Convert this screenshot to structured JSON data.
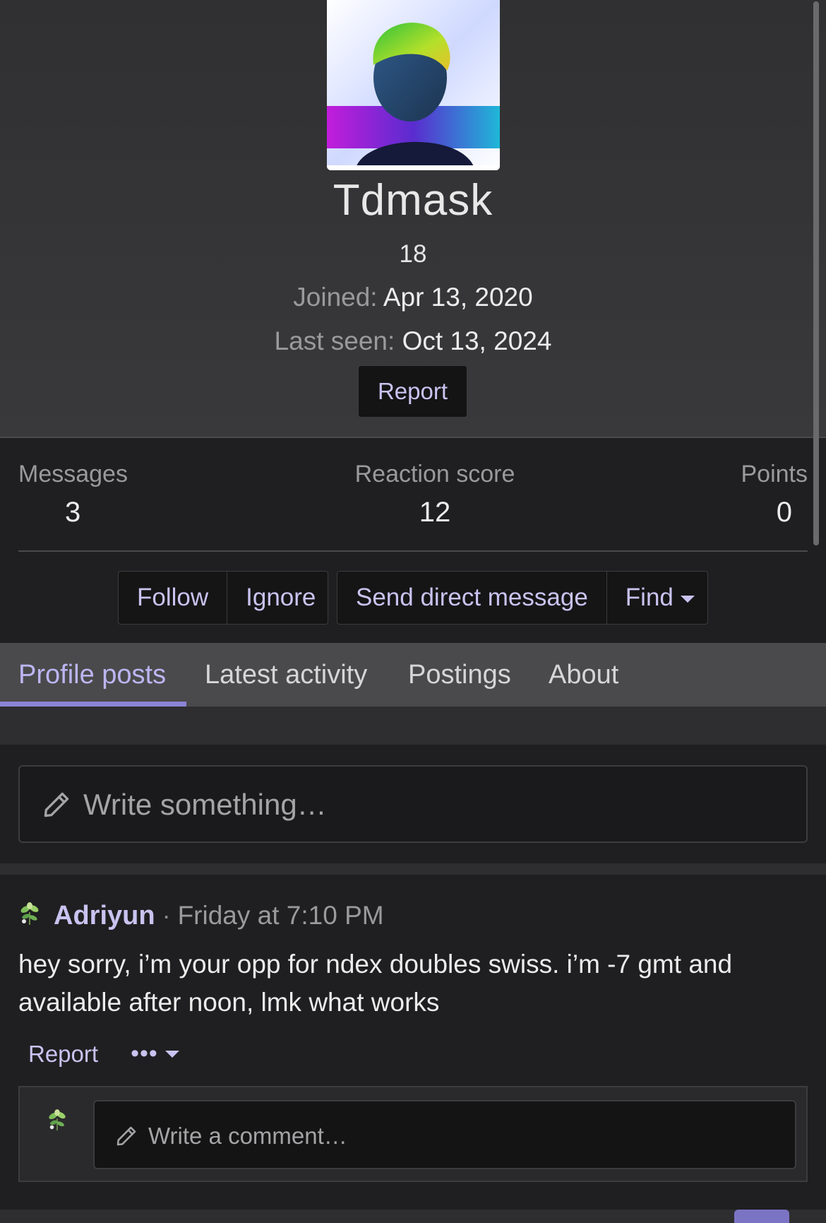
{
  "profile": {
    "username": "Tdmask",
    "title": "18",
    "joined_label": "Joined:",
    "joined_value": "Apr 13, 2020",
    "last_seen_label": "Last seen:",
    "last_seen_value": "Oct 13, 2024",
    "report_label": "Report"
  },
  "stats": [
    {
      "label": "Messages",
      "value": "3"
    },
    {
      "label": "Reaction score",
      "value": "12"
    },
    {
      "label": "Points",
      "value": "0"
    }
  ],
  "actions": {
    "follow": "Follow",
    "ignore": "Ignore",
    "send_dm": "Send direct message",
    "find": "Find"
  },
  "tabs": [
    {
      "label": "Profile posts",
      "active": true
    },
    {
      "label": "Latest activity",
      "active": false
    },
    {
      "label": "Postings",
      "active": false
    },
    {
      "label": "About",
      "active": false
    }
  ],
  "composer": {
    "placeholder": "Write something…"
  },
  "post": {
    "author": "Adriyun",
    "separator": "·",
    "time": "Friday at 7:10 PM",
    "body": "hey sorry, i’m your opp for ndex doubles swiss. i’m -7 gmt and available after noon, lmk what works",
    "report_label": "Report",
    "more_label": "•••",
    "comment_placeholder": "Write a comment…"
  },
  "colors": {
    "accent": "#c9c3f0",
    "tab_underline": "#8b84d6",
    "background": "#1f1f21",
    "header_bg": "#39393b"
  },
  "icons": [
    "pencil-icon",
    "caret-down-icon",
    "plant-avatar-icon"
  ]
}
